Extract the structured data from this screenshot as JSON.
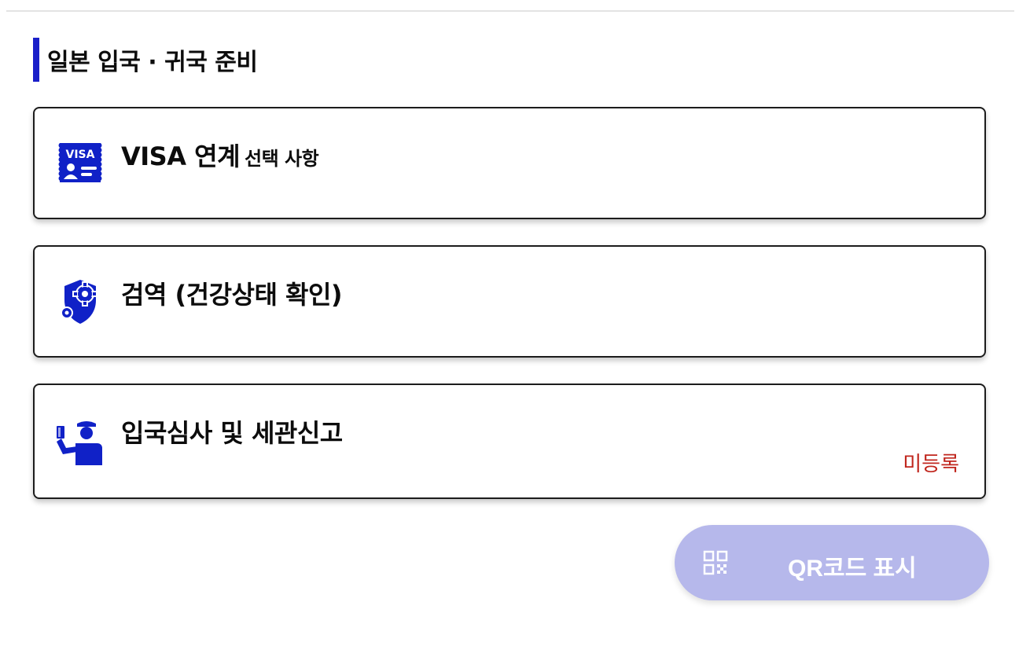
{
  "section": {
    "title": "일본 입국 · 귀국 준비"
  },
  "cards": [
    {
      "title": "VISA 연계",
      "subtitle": "선택 사항",
      "icon": "visa-card-icon",
      "status": ""
    },
    {
      "title": "검역 (건강상태 확인)",
      "subtitle": "",
      "icon": "shield-gear-icon",
      "status": ""
    },
    {
      "title": "입국심사 및 세관신고",
      "subtitle": "",
      "icon": "customs-officer-icon",
      "status": "미등록"
    }
  ],
  "qr_button": {
    "label": "QR코드 표시",
    "icon": "qr-code-icon"
  },
  "colors": {
    "accent": "#1a1fc9",
    "icon": "#1021c7",
    "status_unregistered": "#c0261d",
    "button_disabled": "#b6b8eb"
  }
}
